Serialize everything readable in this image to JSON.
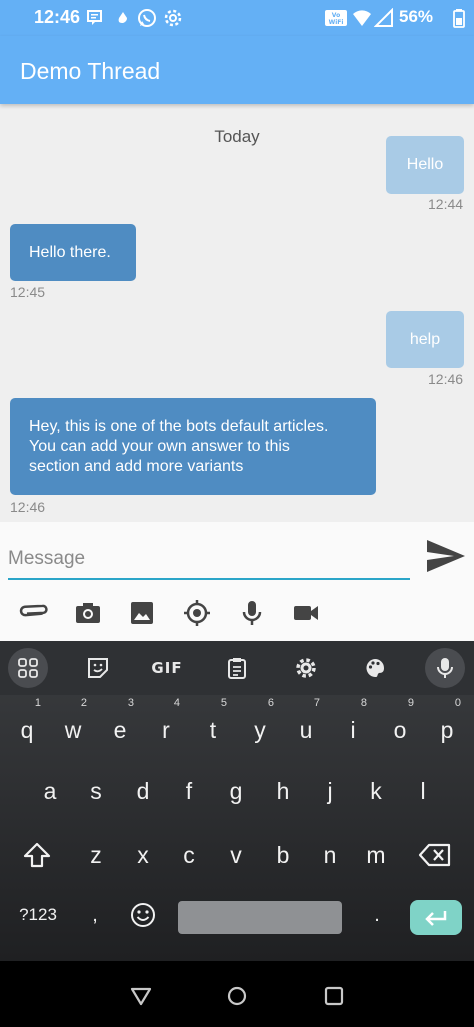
{
  "status_bar": {
    "time": "12:46",
    "battery_percent": "56%",
    "icons": [
      "message-icon",
      "cloud-drop-icon",
      "whatsapp-icon",
      "settings-icon",
      "volte-wifi-icon",
      "wifi-icon",
      "signal-icon",
      "battery-icon"
    ]
  },
  "app_bar": {
    "title": "Demo Thread",
    "color": "#64b0f5"
  },
  "chat": {
    "date_separator": "Today",
    "messages": [
      {
        "direction": "outgoing",
        "text": "Hello",
        "time": "12:44"
      },
      {
        "direction": "incoming",
        "text": "Hello there.",
        "time": "12:45"
      },
      {
        "direction": "outgoing",
        "text": "help",
        "time": "12:46"
      },
      {
        "direction": "incoming",
        "lines": [
          "Hey, this is one of the bots default articles.",
          "You can add your own answer to this",
          "section and add more variants"
        ],
        "time": "12:46"
      }
    ],
    "incoming_color": "#4f8cc2",
    "outgoing_color": "#a9cbe6"
  },
  "composer": {
    "placeholder": "Message",
    "value": "",
    "accent_color": "#2aa5c8",
    "send_icon": "send-icon",
    "tools": [
      "attachment-icon",
      "camera-icon",
      "image-icon",
      "location-icon",
      "microphone-icon",
      "video-icon"
    ]
  },
  "keyboard": {
    "toolbar": [
      "apps-grid-icon",
      "sticker-icon",
      "GIF",
      "clipboard-icon",
      "settings-icon",
      "palette-icon",
      "microphone-icon"
    ],
    "row1": [
      {
        "key": "q",
        "hint": "1"
      },
      {
        "key": "w",
        "hint": "2"
      },
      {
        "key": "e",
        "hint": "3"
      },
      {
        "key": "r",
        "hint": "4"
      },
      {
        "key": "t",
        "hint": "5"
      },
      {
        "key": "y",
        "hint": "6"
      },
      {
        "key": "u",
        "hint": "7"
      },
      {
        "key": "i",
        "hint": "8"
      },
      {
        "key": "o",
        "hint": "9"
      },
      {
        "key": "p",
        "hint": "0"
      }
    ],
    "row2": [
      "a",
      "s",
      "d",
      "f",
      "g",
      "h",
      "j",
      "k",
      "l"
    ],
    "row3": [
      "z",
      "x",
      "c",
      "v",
      "b",
      "n",
      "m"
    ],
    "symbols_label": "?123",
    "comma": ",",
    "period": ".",
    "enter_color": "#7fd3c7"
  },
  "nav_bar": [
    "back-icon",
    "home-icon",
    "recents-icon"
  ]
}
